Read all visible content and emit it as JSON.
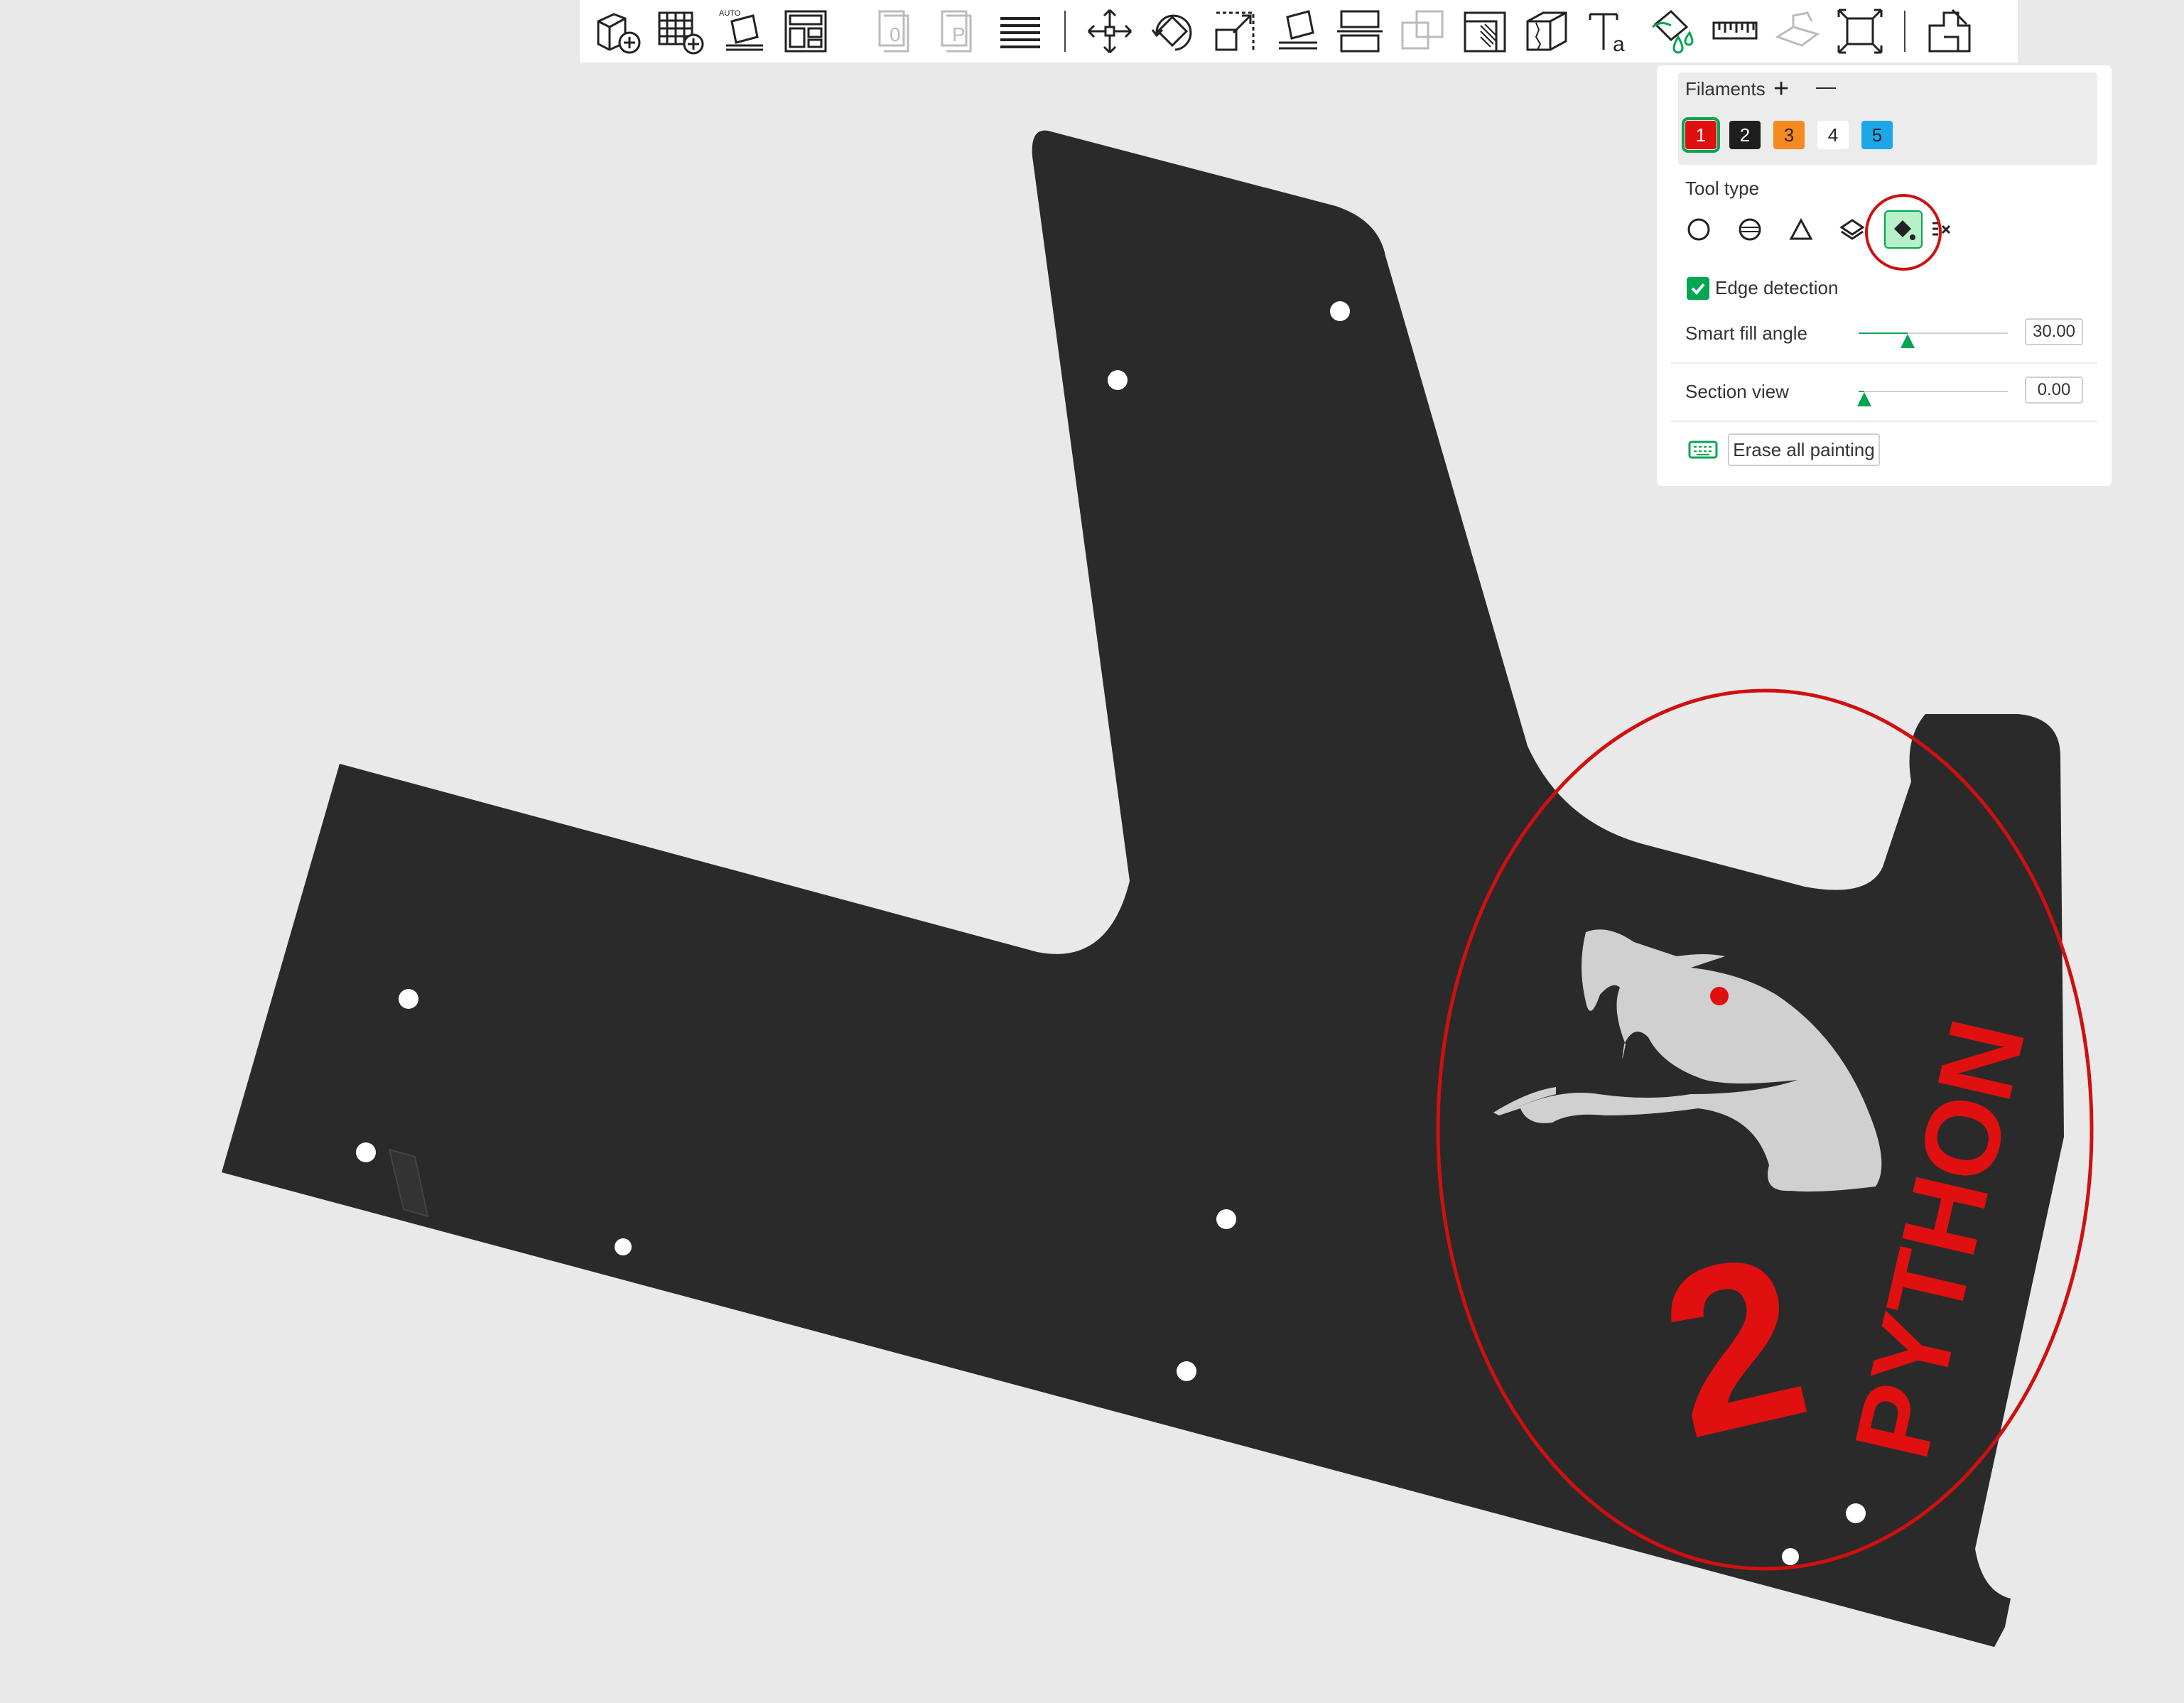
{
  "toolbar": {
    "buttons": [
      {
        "name": "add-object-icon"
      },
      {
        "name": "add-plate-icon"
      },
      {
        "name": "auto-orient-icon",
        "label": "AUTO"
      },
      {
        "name": "arrange-icon"
      },
      {
        "name": "plate-objects-icon",
        "label": "0"
      },
      {
        "name": "plate-parts-icon",
        "label": "P"
      },
      {
        "name": "layers-icon"
      },
      {
        "name": "move-icon"
      },
      {
        "name": "rotate-icon"
      },
      {
        "name": "scale-icon"
      },
      {
        "name": "lay-on-face-icon"
      },
      {
        "name": "cut-icon"
      },
      {
        "name": "mesh-boolean-icon"
      },
      {
        "name": "support-painting-icon"
      },
      {
        "name": "seam-painting-icon"
      },
      {
        "name": "text-icon",
        "label": "T",
        "sub": "a"
      },
      {
        "name": "color-painting-icon"
      },
      {
        "name": "measure-icon"
      },
      {
        "name": "emboss-icon"
      },
      {
        "name": "fit-view-icon"
      },
      {
        "name": "assembly-icon"
      }
    ]
  },
  "panel": {
    "filaments_label": "Filaments",
    "plus": "+",
    "minus": "—",
    "filaments": [
      {
        "label": "1",
        "color": "#e01010",
        "text_color": "#ffffff",
        "selected": true
      },
      {
        "label": "2",
        "color": "#1e1e1e",
        "text_color": "#ffffff",
        "selected": false
      },
      {
        "label": "3",
        "color": "#f58a1f",
        "text_color": "#222222",
        "selected": false
      },
      {
        "label": "4",
        "color": "#ffffff",
        "text_color": "#222222",
        "selected": false
      },
      {
        "label": "5",
        "color": "#1ea7e8",
        "text_color": "#222222",
        "selected": false
      }
    ],
    "tool_type_label": "Tool type",
    "tools": [
      "circle-tool-icon",
      "sphere-tool-icon",
      "triangle-tool-icon",
      "height-range-tool-icon",
      "fill-tool-icon",
      "gap-fill-tool-icon"
    ],
    "active_tool": "fill-tool-icon",
    "edge_detection_label": "Edge detection",
    "edge_detection_checked": true,
    "smart_fill_label": "Smart fill angle",
    "smart_fill_value": "30.00",
    "smart_fill_fraction": 0.33,
    "section_view_label": "Section view",
    "section_view_value": "0.00",
    "section_view_fraction": 0.0,
    "erase_label": "Erase all painting"
  },
  "model": {
    "logo_number": "2",
    "logo_text": "PYTHON",
    "accent": "#e01010",
    "plate_color": "#2a2a2a",
    "snake_color": "#d0d0d0"
  }
}
